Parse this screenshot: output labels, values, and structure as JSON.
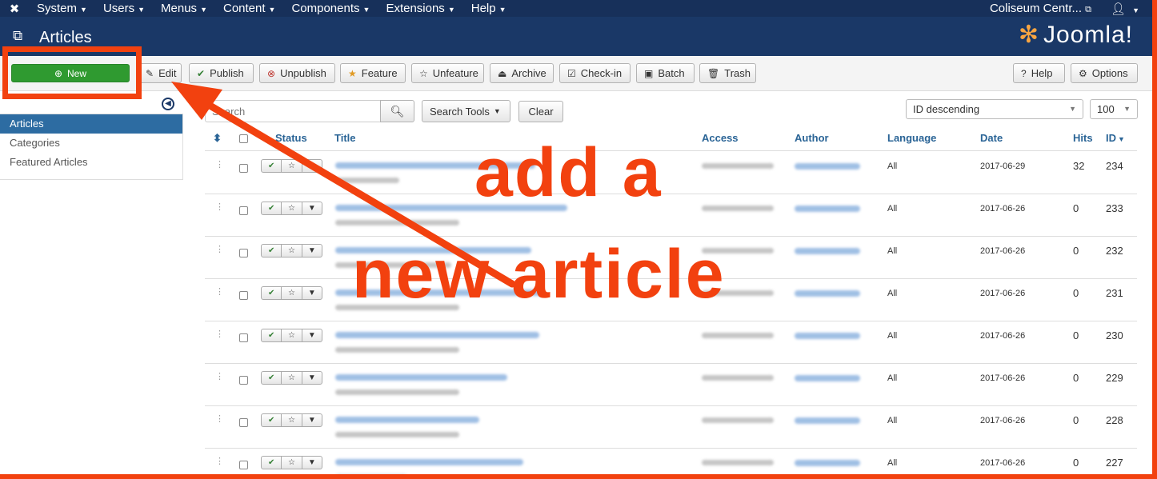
{
  "topnav": {
    "menus": [
      "System",
      "Users",
      "Menus",
      "Content",
      "Components",
      "Extensions",
      "Help"
    ],
    "site": "Coliseum Centr...",
    "site_icon": "external-link-icon",
    "user_icon": "user-icon"
  },
  "header": {
    "title": "Articles",
    "brand": "Joomla!"
  },
  "toolbar": {
    "new": "New",
    "edit": "Edit",
    "publish": "Publish",
    "unpublish": "Unpublish",
    "feature": "Feature",
    "unfeature": "Unfeature",
    "archive": "Archive",
    "checkin": "Check-in",
    "batch": "Batch",
    "trash": "Trash",
    "help": "Help",
    "options": "Options"
  },
  "sidebar": {
    "items": [
      {
        "label": "Articles",
        "active": true
      },
      {
        "label": "Categories",
        "active": false
      },
      {
        "label": "Featured Articles",
        "active": false
      }
    ]
  },
  "filters": {
    "search_placeholder": "Search",
    "search_tools": "Search Tools",
    "clear": "Clear",
    "ordering": "ID descending",
    "limit": "100"
  },
  "table": {
    "columns": {
      "status": "Status",
      "title": "Title",
      "access": "Access",
      "author": "Author",
      "language": "Language",
      "date": "Date",
      "hits": "Hits",
      "id": "ID"
    },
    "rows": [
      {
        "language": "All",
        "date": "2017-06-29",
        "hits": "32",
        "id": "234"
      },
      {
        "language": "All",
        "date": "2017-06-26",
        "hits": "0",
        "id": "233"
      },
      {
        "language": "All",
        "date": "2017-06-26",
        "hits": "0",
        "id": "232"
      },
      {
        "language": "All",
        "date": "2017-06-26",
        "hits": "0",
        "id": "231"
      },
      {
        "language": "All",
        "date": "2017-06-26",
        "hits": "0",
        "id": "230"
      },
      {
        "language": "All",
        "date": "2017-06-26",
        "hits": "0",
        "id": "229"
      },
      {
        "language": "All",
        "date": "2017-06-26",
        "hits": "0",
        "id": "228"
      },
      {
        "language": "All",
        "date": "2017-06-26",
        "hits": "0",
        "id": "227"
      }
    ]
  },
  "annotation": {
    "line1": "add a",
    "line2": "new  article",
    "color": "#f2410f"
  }
}
